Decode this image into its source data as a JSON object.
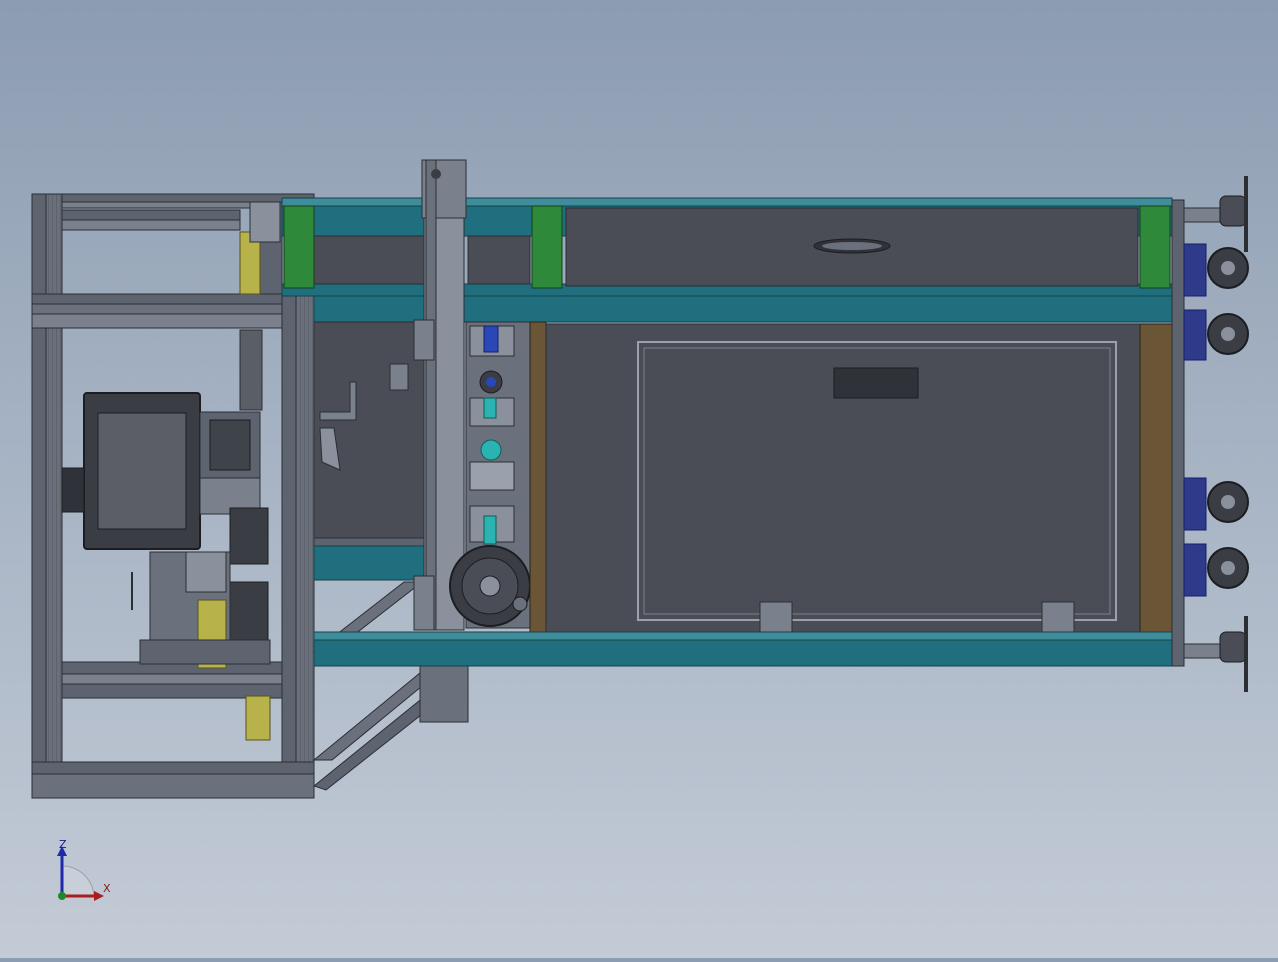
{
  "triad": {
    "z_label": "Z",
    "x_label": "X"
  },
  "colors": {
    "background_top": "#8c9cb1",
    "background_bottom": "#c3cbd6",
    "frame_steel": "#5d6470",
    "frame_dark": "#3c4047",
    "teal_beam": "#1f6f7e",
    "green_block": "#2e8a3a",
    "panel_dark": "#4a4d55",
    "brown_panel": "#6b5537",
    "yellow_part": "#b8b24a",
    "wheel_blue": "#303a8a",
    "cyan_part": "#2ab3b0",
    "blue_part": "#2a47b8"
  },
  "icons": [
    "view-triad-icon",
    "caster-wheel-icon",
    "handwheel-icon"
  ]
}
